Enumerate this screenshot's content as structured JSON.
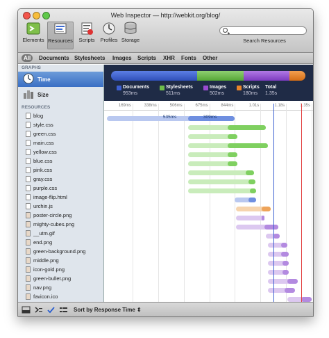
{
  "window": {
    "title": "Web Inspector — http://webkit.org/blog/"
  },
  "toolbar": {
    "items": [
      {
        "label": "Elements",
        "icon": "elements-icon"
      },
      {
        "label": "Resources",
        "icon": "resources-icon",
        "selected": true
      },
      {
        "label": "Scripts",
        "icon": "scripts-icon"
      },
      {
        "label": "Profiles",
        "icon": "profiles-icon"
      },
      {
        "label": "Storage",
        "icon": "storage-icon"
      }
    ],
    "search_label": "Search Resources",
    "search_placeholder": ""
  },
  "scopebar": {
    "items": [
      "All",
      "Documents",
      "Stylesheets",
      "Images",
      "Scripts",
      "XHR",
      "Fonts",
      "Other"
    ],
    "active": "All"
  },
  "sidebar": {
    "graphs_header": "GRAPHS",
    "graphs": [
      {
        "label": "Time",
        "icon": "clock-icon",
        "selected": true
      },
      {
        "label": "Size",
        "icon": "size-icon",
        "selected": false
      }
    ],
    "resources_header": "RESOURCES",
    "resources": [
      {
        "name": "blog",
        "type": "document"
      },
      {
        "name": "style.css",
        "type": "stylesheet"
      },
      {
        "name": "green.css",
        "type": "stylesheet"
      },
      {
        "name": "main.css",
        "type": "stylesheet"
      },
      {
        "name": "yellow.css",
        "type": "stylesheet"
      },
      {
        "name": "blue.css",
        "type": "stylesheet"
      },
      {
        "name": "pink.css",
        "type": "stylesheet"
      },
      {
        "name": "gray.css",
        "type": "stylesheet"
      },
      {
        "name": "purple.css",
        "type": "stylesheet"
      },
      {
        "name": "image-flip.html",
        "type": "document"
      },
      {
        "name": "urchin.js",
        "type": "script"
      },
      {
        "name": "poster-circle.png",
        "type": "image"
      },
      {
        "name": "mighty-cubes.png",
        "type": "image"
      },
      {
        "name": "__utm.gif",
        "type": "image"
      },
      {
        "name": "end.png",
        "type": "image"
      },
      {
        "name": "green-background.png",
        "type": "image"
      },
      {
        "name": "middle.png",
        "type": "image"
      },
      {
        "name": "icon-gold.png",
        "type": "image"
      },
      {
        "name": "green-bullet.png",
        "type": "image"
      },
      {
        "name": "nav.png",
        "type": "image"
      },
      {
        "name": "favicon.ico",
        "type": "image"
      }
    ]
  },
  "summary": {
    "legend": [
      {
        "label": "Documents",
        "value": "953ms",
        "color": "#3d5fd1"
      },
      {
        "label": "Stylesheets",
        "value": "511ms",
        "color": "#6fbf4a"
      },
      {
        "label": "Images",
        "value": "502ms",
        "color": "#9b4bd1"
      },
      {
        "label": "Scripts",
        "value": "180ms",
        "color": "#e9842a"
      },
      {
        "label": "Total",
        "value": "1.35s",
        "color": ""
      }
    ]
  },
  "timeline": {
    "ticks": [
      "169ms",
      "338ms",
      "506ms",
      "675ms",
      "844ms",
      "1.01s",
      "1.18s",
      "1.35s"
    ],
    "total_ms": 1350,
    "blog_labels": [
      "535ms",
      "309ms"
    ],
    "rows": [
      {
        "type": "document",
        "start": 0,
        "latency": 535,
        "end": 844
      },
      {
        "type": "stylesheet",
        "start": 535,
        "latency": 260,
        "end": 1050
      },
      {
        "type": "stylesheet",
        "start": 535,
        "latency": 260,
        "end": 860
      },
      {
        "type": "stylesheet",
        "start": 535,
        "latency": 260,
        "end": 1060
      },
      {
        "type": "stylesheet",
        "start": 535,
        "latency": 260,
        "end": 860
      },
      {
        "type": "stylesheet",
        "start": 535,
        "latency": 260,
        "end": 860
      },
      {
        "type": "stylesheet",
        "start": 535,
        "latency": 380,
        "end": 970
      },
      {
        "type": "stylesheet",
        "start": 535,
        "latency": 400,
        "end": 980
      },
      {
        "type": "stylesheet",
        "start": 535,
        "latency": 410,
        "end": 985
      },
      {
        "type": "document",
        "start": 840,
        "latency": 95,
        "end": 985
      },
      {
        "type": "script",
        "start": 850,
        "latency": 170,
        "end": 1080
      },
      {
        "type": "image",
        "start": 850,
        "latency": 170,
        "end": 1040
      },
      {
        "type": "image",
        "start": 850,
        "latency": 190,
        "end": 1130
      },
      {
        "type": "image",
        "start": 1050,
        "latency": 50,
        "end": 1140
      },
      {
        "type": "image",
        "start": 1060,
        "latency": 90,
        "end": 1190
      },
      {
        "type": "image",
        "start": 1060,
        "latency": 90,
        "end": 1200
      },
      {
        "type": "image",
        "start": 1060,
        "latency": 100,
        "end": 1200
      },
      {
        "type": "image",
        "start": 1060,
        "latency": 100,
        "end": 1200
      },
      {
        "type": "image",
        "start": 1060,
        "latency": 130,
        "end": 1260
      },
      {
        "type": "image",
        "start": 1060,
        "latency": 110,
        "end": 1240
      },
      {
        "type": "image",
        "start": 1190,
        "latency": 90,
        "end": 1350
      }
    ],
    "colors": {
      "document": {
        "light": "#b9c8f0",
        "dark": "#6f8fe0"
      },
      "stylesheet": {
        "light": "#c9ecbb",
        "dark": "#7fd060"
      },
      "script": {
        "light": "#f6d4ae",
        "dark": "#eea45a"
      },
      "image": {
        "light": "#dcc8f0",
        "dark": "#b38ae0"
      }
    },
    "dom_content_loaded_ms": 1100,
    "load_ms": 1280
  },
  "statusbar": {
    "sort_label": "Sort by Response Time"
  }
}
